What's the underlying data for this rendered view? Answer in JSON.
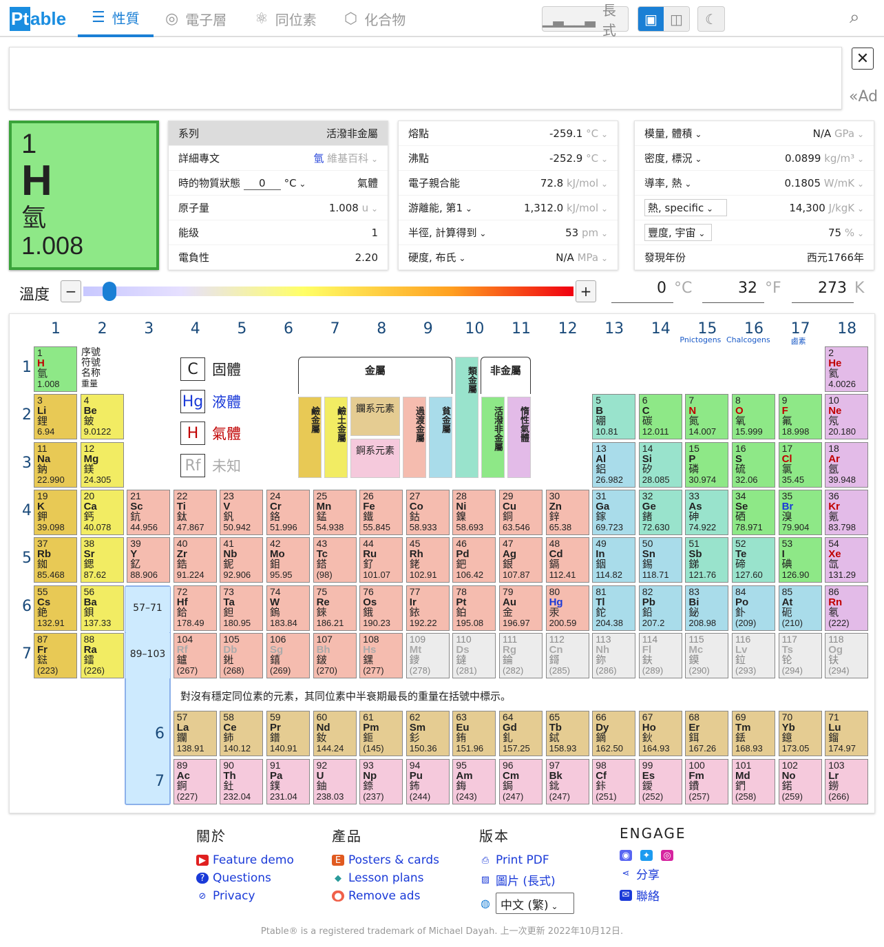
{
  "nav": {
    "logo_pt": "Pt",
    "logo_rest": "able",
    "tabs": [
      "性質",
      "電子層",
      "同位素",
      "化合物"
    ],
    "wide_label": "長式"
  },
  "ad": {
    "tag": "«Ad",
    "close": "✕"
  },
  "element": {
    "number": "1",
    "symbol": "H",
    "name": "氫",
    "mass": "1.008"
  },
  "panel1": [
    {
      "k": "系列",
      "v": "活潑非金屬",
      "u": ""
    },
    {
      "k": "詳細專文",
      "v": "氫",
      "u": "維基百科"
    },
    {
      "k": "時的物質狀態",
      "t": "0",
      "tu": "°C",
      "v": "氣體",
      "u": ""
    },
    {
      "k": "原子量",
      "v": "1.008",
      "u": "u"
    },
    {
      "k": "能级",
      "v": "1",
      "u": ""
    },
    {
      "k": "電負性",
      "v": "2.20",
      "u": ""
    }
  ],
  "panel2": [
    {
      "k": "熔點",
      "v": "-259.1",
      "u": "°C"
    },
    {
      "k": "沸點",
      "v": "-252.9",
      "u": "°C"
    },
    {
      "k": "電子親合能",
      "v": "72.8",
      "u": "kJ/mol"
    },
    {
      "k": "游離能, 第1",
      "v": "1,312.0",
      "u": "kJ/mol"
    },
    {
      "k": "半徑, 計算得到",
      "v": "53",
      "u": "pm"
    },
    {
      "k": "硬度, 布氏",
      "v": "N/A",
      "u": "MPa"
    }
  ],
  "panel3": [
    {
      "k": "模量, 體積",
      "v": "N/A",
      "u": "GPa"
    },
    {
      "k": "密度, 標況",
      "v": "0.0899",
      "u": "kg/m³"
    },
    {
      "k": "導率, 熱",
      "v": "0.1805",
      "u": "W/mK"
    },
    {
      "k": "熱, specific",
      "v": "14,300",
      "u": "J/kgK"
    },
    {
      "k": "豐度, 宇宙",
      "v": "75",
      "u": "%"
    },
    {
      "k": "發現年份",
      "v": "西元1766年",
      "u": ""
    }
  ],
  "temperature": {
    "label": "溫度",
    "minus": "−",
    "plus": "+",
    "c": "0",
    "c_unit": "°C",
    "f": "32",
    "f_unit": "°F",
    "k": "273",
    "k_unit": "K",
    "slider_fraction": 0.05
  },
  "table": {
    "groups": [
      "1",
      "2",
      "3",
      "4",
      "5",
      "6",
      "7",
      "8",
      "9",
      "10",
      "11",
      "12",
      "13",
      "14",
      "15",
      "16",
      "17",
      "18"
    ],
    "group_sub": {
      "15": "Pnictogens",
      "16": "Chalcogens",
      "17": "鹵素"
    },
    "periods": [
      "1",
      "2",
      "3",
      "4",
      "5",
      "6",
      "7"
    ],
    "key_lines": [
      "序號",
      "符號",
      "名称",
      "重量"
    ],
    "legend": [
      {
        "sym": "C",
        "label": "固體",
        "cls": ""
      },
      {
        "sym": "Hg",
        "label": "液體",
        "cls": "liq"
      },
      {
        "sym": "H",
        "label": "氣體",
        "cls": "gas"
      },
      {
        "sym": "Rf",
        "label": "未知",
        "cls": "unk"
      }
    ],
    "cat_metals": "金屬",
    "cat_nonmetals": "非金屬",
    "cat_lan": "鑭系元素",
    "cat_act": "錒系元素",
    "cat_vertical": [
      "鹼金屬",
      "鹼土金屬",
      "過渡金屬",
      "貧金屬",
      "類金屬",
      "活潑非金屬",
      "惰性氣體"
    ],
    "lan_range": "57–71",
    "act_range": "89–103",
    "note": "對沒有穩定同位素的元素，其同位素中半衰期最長的重量在括號中標示。",
    "lan_period": "6",
    "act_period": "7"
  },
  "elements": [
    [
      "1",
      "H",
      "氫",
      "1.008",
      1,
      1,
      "non",
      "gas"
    ],
    [
      "2",
      "He",
      "氦",
      "4.0026",
      18,
      1,
      "nob",
      "gas"
    ],
    [
      "3",
      "Li",
      "鋰",
      "6.94",
      1,
      2,
      "alk",
      ""
    ],
    [
      "4",
      "Be",
      "鈹",
      "9.0122",
      2,
      2,
      "alke",
      ""
    ],
    [
      "5",
      "B",
      "硼",
      "10.81",
      13,
      2,
      "met",
      ""
    ],
    [
      "6",
      "C",
      "碳",
      "12.011",
      14,
      2,
      "non",
      ""
    ],
    [
      "7",
      "N",
      "氮",
      "14.007",
      15,
      2,
      "non",
      "gas"
    ],
    [
      "8",
      "O",
      "氧",
      "15.999",
      16,
      2,
      "non",
      "gas"
    ],
    [
      "9",
      "F",
      "氟",
      "18.998",
      17,
      2,
      "hal",
      "gas"
    ],
    [
      "10",
      "Ne",
      "氖",
      "20.180",
      18,
      2,
      "nob",
      "gas"
    ],
    [
      "11",
      "Na",
      "鈉",
      "22.990",
      1,
      3,
      "alk",
      ""
    ],
    [
      "12",
      "Mg",
      "鎂",
      "24.305",
      2,
      3,
      "alke",
      ""
    ],
    [
      "13",
      "Al",
      "鋁",
      "26.982",
      13,
      3,
      "ptm",
      ""
    ],
    [
      "14",
      "Si",
      "矽",
      "28.085",
      14,
      3,
      "met",
      ""
    ],
    [
      "15",
      "P",
      "磷",
      "30.974",
      15,
      3,
      "non",
      ""
    ],
    [
      "16",
      "S",
      "硫",
      "32.06",
      16,
      3,
      "non",
      ""
    ],
    [
      "17",
      "Cl",
      "氯",
      "35.45",
      17,
      3,
      "hal",
      "gas"
    ],
    [
      "18",
      "Ar",
      "氬",
      "39.948",
      18,
      3,
      "nob",
      "gas"
    ],
    [
      "19",
      "K",
      "鉀",
      "39.098",
      1,
      4,
      "alk",
      ""
    ],
    [
      "20",
      "Ca",
      "鈣",
      "40.078",
      2,
      4,
      "alke",
      ""
    ],
    [
      "21",
      "Sc",
      "鈧",
      "44.956",
      3,
      4,
      "tm",
      ""
    ],
    [
      "22",
      "Ti",
      "鈦",
      "47.867",
      4,
      4,
      "tm",
      ""
    ],
    [
      "23",
      "V",
      "釩",
      "50.942",
      5,
      4,
      "tm",
      ""
    ],
    [
      "24",
      "Cr",
      "鉻",
      "51.996",
      6,
      4,
      "tm",
      ""
    ],
    [
      "25",
      "Mn",
      "錳",
      "54.938",
      7,
      4,
      "tm",
      ""
    ],
    [
      "26",
      "Fe",
      "鐵",
      "55.845",
      8,
      4,
      "tm",
      ""
    ],
    [
      "27",
      "Co",
      "鈷",
      "58.933",
      9,
      4,
      "tm",
      ""
    ],
    [
      "28",
      "Ni",
      "鎳",
      "58.693",
      10,
      4,
      "tm",
      ""
    ],
    [
      "29",
      "Cu",
      "銅",
      "63.546",
      11,
      4,
      "tm",
      ""
    ],
    [
      "30",
      "Zn",
      "鋅",
      "65.38",
      12,
      4,
      "tm",
      ""
    ],
    [
      "31",
      "Ga",
      "鎵",
      "69.723",
      13,
      4,
      "ptm",
      ""
    ],
    [
      "32",
      "Ge",
      "鍺",
      "72.630",
      14,
      4,
      "met",
      ""
    ],
    [
      "33",
      "As",
      "砷",
      "74.922",
      15,
      4,
      "met",
      ""
    ],
    [
      "34",
      "Se",
      "硒",
      "78.971",
      16,
      4,
      "non",
      ""
    ],
    [
      "35",
      "Br",
      "溴",
      "79.904",
      17,
      4,
      "hal",
      "liq"
    ],
    [
      "36",
      "Kr",
      "氪",
      "83.798",
      18,
      4,
      "nob",
      "gas"
    ],
    [
      "37",
      "Rb",
      "銣",
      "85.468",
      1,
      5,
      "alk",
      ""
    ],
    [
      "38",
      "Sr",
      "鍶",
      "87.62",
      2,
      5,
      "alke",
      ""
    ],
    [
      "39",
      "Y",
      "釔",
      "88.906",
      3,
      5,
      "tm",
      ""
    ],
    [
      "40",
      "Zr",
      "鋯",
      "91.224",
      4,
      5,
      "tm",
      ""
    ],
    [
      "41",
      "Nb",
      "鈮",
      "92.906",
      5,
      5,
      "tm",
      ""
    ],
    [
      "42",
      "Mo",
      "鉬",
      "95.95",
      6,
      5,
      "tm",
      ""
    ],
    [
      "43",
      "Tc",
      "鎝",
      "(98)",
      7,
      5,
      "tm",
      ""
    ],
    [
      "44",
      "Ru",
      "釕",
      "101.07",
      8,
      5,
      "tm",
      ""
    ],
    [
      "45",
      "Rh",
      "銠",
      "102.91",
      9,
      5,
      "tm",
      ""
    ],
    [
      "46",
      "Pd",
      "鈀",
      "106.42",
      10,
      5,
      "tm",
      ""
    ],
    [
      "47",
      "Ag",
      "銀",
      "107.87",
      11,
      5,
      "tm",
      ""
    ],
    [
      "48",
      "Cd",
      "鎘",
      "112.41",
      12,
      5,
      "tm",
      ""
    ],
    [
      "49",
      "In",
      "銦",
      "114.82",
      13,
      5,
      "ptm",
      ""
    ],
    [
      "50",
      "Sn",
      "錫",
      "118.71",
      14,
      5,
      "ptm",
      ""
    ],
    [
      "51",
      "Sb",
      "銻",
      "121.76",
      15,
      5,
      "met",
      ""
    ],
    [
      "52",
      "Te",
      "碲",
      "127.60",
      16,
      5,
      "met",
      ""
    ],
    [
      "53",
      "I",
      "碘",
      "126.90",
      17,
      5,
      "hal",
      ""
    ],
    [
      "54",
      "Xe",
      "氙",
      "131.29",
      18,
      5,
      "nob",
      "gas"
    ],
    [
      "55",
      "Cs",
      "銫",
      "132.91",
      1,
      6,
      "alk",
      ""
    ],
    [
      "56",
      "Ba",
      "鋇",
      "137.33",
      2,
      6,
      "alke",
      ""
    ],
    [
      "72",
      "Hf",
      "鉿",
      "178.49",
      4,
      6,
      "tm",
      ""
    ],
    [
      "73",
      "Ta",
      "鉭",
      "180.95",
      5,
      6,
      "tm",
      ""
    ],
    [
      "74",
      "W",
      "鎢",
      "183.84",
      6,
      6,
      "tm",
      ""
    ],
    [
      "75",
      "Re",
      "錸",
      "186.21",
      7,
      6,
      "tm",
      ""
    ],
    [
      "76",
      "Os",
      "鋨",
      "190.23",
      8,
      6,
      "tm",
      ""
    ],
    [
      "77",
      "Ir",
      "銥",
      "192.22",
      9,
      6,
      "tm",
      ""
    ],
    [
      "78",
      "Pt",
      "鉑",
      "195.08",
      10,
      6,
      "tm",
      ""
    ],
    [
      "79",
      "Au",
      "金",
      "196.97",
      11,
      6,
      "tm",
      ""
    ],
    [
      "80",
      "Hg",
      "汞",
      "200.59",
      12,
      6,
      "tm",
      "liq"
    ],
    [
      "81",
      "Tl",
      "鉈",
      "204.38",
      13,
      6,
      "ptm",
      ""
    ],
    [
      "82",
      "Pb",
      "鉛",
      "207.2",
      14,
      6,
      "ptm",
      ""
    ],
    [
      "83",
      "Bi",
      "鉍",
      "208.98",
      15,
      6,
      "ptm",
      ""
    ],
    [
      "84",
      "Po",
      "釙",
      "(209)",
      16,
      6,
      "ptm",
      ""
    ],
    [
      "85",
      "At",
      "砈",
      "(210)",
      17,
      6,
      "ptm",
      ""
    ],
    [
      "86",
      "Rn",
      "氡",
      "(222)",
      18,
      6,
      "nob",
      "gas"
    ],
    [
      "87",
      "Fr",
      "鍅",
      "(223)",
      1,
      7,
      "alk",
      ""
    ],
    [
      "88",
      "Ra",
      "鐳",
      "(226)",
      2,
      7,
      "alke",
      ""
    ],
    [
      "104",
      "Rf",
      "鑪",
      "(267)",
      4,
      7,
      "tm",
      "unk"
    ],
    [
      "105",
      "Db",
      "𨧀",
      "(268)",
      5,
      7,
      "tm",
      "unk"
    ],
    [
      "106",
      "Sg",
      "𨭎",
      "(269)",
      6,
      7,
      "tm",
      "unk"
    ],
    [
      "107",
      "Bh",
      "𨨏",
      "(270)",
      7,
      7,
      "tm",
      "unk"
    ],
    [
      "108",
      "Hs",
      "𨭆",
      "(277)",
      8,
      7,
      "tm",
      "unk"
    ],
    [
      "109",
      "Mt",
      "䥑",
      "(278)",
      9,
      7,
      "unk",
      "unk"
    ],
    [
      "110",
      "Ds",
      "鐽",
      "(281)",
      10,
      7,
      "unk",
      "unk"
    ],
    [
      "111",
      "Rg",
      "錀",
      "(282)",
      11,
      7,
      "unk",
      "unk"
    ],
    [
      "112",
      "Cn",
      "鎶",
      "(285)",
      12,
      7,
      "unk",
      "unk"
    ],
    [
      "113",
      "Nh",
      "鉨",
      "(286)",
      13,
      7,
      "unk",
      "unk"
    ],
    [
      "114",
      "Fl",
      "鈇",
      "(289)",
      14,
      7,
      "unk",
      "unk"
    ],
    [
      "115",
      "Mc",
      "鏌",
      "(290)",
      15,
      7,
      "unk",
      "unk"
    ],
    [
      "116",
      "Lv",
      "鉝",
      "(293)",
      16,
      7,
      "unk",
      "unk"
    ],
    [
      "117",
      "Ts",
      "𬬭",
      "(294)",
      17,
      7,
      "unk",
      "unk"
    ],
    [
      "118",
      "Og",
      "𫓧",
      "(294)",
      18,
      7,
      "unk",
      "unk"
    ],
    [
      "57",
      "La",
      "鑭",
      "138.91",
      4,
      9,
      "lan",
      ""
    ],
    [
      "58",
      "Ce",
      "鈰",
      "140.12",
      5,
      9,
      "lan",
      ""
    ],
    [
      "59",
      "Pr",
      "鐠",
      "140.91",
      6,
      9,
      "lan",
      ""
    ],
    [
      "60",
      "Nd",
      "釹",
      "144.24",
      7,
      9,
      "lan",
      ""
    ],
    [
      "61",
      "Pm",
      "鉕",
      "(145)",
      8,
      9,
      "lan",
      ""
    ],
    [
      "62",
      "Sm",
      "釤",
      "150.36",
      9,
      9,
      "lan",
      ""
    ],
    [
      "63",
      "Eu",
      "銪",
      "151.96",
      10,
      9,
      "lan",
      ""
    ],
    [
      "64",
      "Gd",
      "釓",
      "157.25",
      11,
      9,
      "lan",
      ""
    ],
    [
      "65",
      "Tb",
      "鋱",
      "158.93",
      12,
      9,
      "lan",
      ""
    ],
    [
      "66",
      "Dy",
      "鏑",
      "162.50",
      13,
      9,
      "lan",
      ""
    ],
    [
      "67",
      "Ho",
      "鈥",
      "164.93",
      14,
      9,
      "lan",
      ""
    ],
    [
      "68",
      "Er",
      "鉺",
      "167.26",
      15,
      9,
      "lan",
      ""
    ],
    [
      "69",
      "Tm",
      "銩",
      "168.93",
      16,
      9,
      "lan",
      ""
    ],
    [
      "70",
      "Yb",
      "鐿",
      "173.05",
      17,
      9,
      "lan",
      ""
    ],
    [
      "71",
      "Lu",
      "鎦",
      "174.97",
      18,
      9,
      "lan",
      ""
    ],
    [
      "89",
      "Ac",
      "錒",
      "(227)",
      4,
      10,
      "act",
      ""
    ],
    [
      "90",
      "Th",
      "釷",
      "232.04",
      5,
      10,
      "act",
      ""
    ],
    [
      "91",
      "Pa",
      "鏷",
      "231.04",
      6,
      10,
      "act",
      ""
    ],
    [
      "92",
      "U",
      "鈾",
      "238.03",
      7,
      10,
      "act",
      ""
    ],
    [
      "93",
      "Np",
      "錼",
      "(237)",
      8,
      10,
      "act",
      ""
    ],
    [
      "94",
      "Pu",
      "鈽",
      "(244)",
      9,
      10,
      "act",
      ""
    ],
    [
      "95",
      "Am",
      "鋂",
      "(243)",
      10,
      10,
      "act",
      ""
    ],
    [
      "96",
      "Cm",
      "鋦",
      "(247)",
      11,
      10,
      "act",
      ""
    ],
    [
      "97",
      "Bk",
      "鉳",
      "(247)",
      12,
      10,
      "act",
      ""
    ],
    [
      "98",
      "Cf",
      "鉲",
      "(251)",
      13,
      10,
      "act",
      ""
    ],
    [
      "99",
      "Es",
      "鑀",
      "(252)",
      14,
      10,
      "act",
      ""
    ],
    [
      "100",
      "Fm",
      "鐨",
      "(257)",
      15,
      10,
      "act",
      ""
    ],
    [
      "101",
      "Md",
      "鍆",
      "(258)",
      16,
      10,
      "act",
      ""
    ],
    [
      "102",
      "No",
      "鍩",
      "(259)",
      17,
      10,
      "act",
      ""
    ],
    [
      "103",
      "Lr",
      "鐒",
      "(266)",
      18,
      10,
      "act",
      ""
    ]
  ],
  "footer": {
    "about": {
      "title": "關於",
      "items": [
        "Feature demo",
        "Questions",
        "Privacy"
      ]
    },
    "products": {
      "title": "產品",
      "items": [
        "Posters & cards",
        "Lesson plans",
        "Remove ads"
      ]
    },
    "version": {
      "title": "版本",
      "items": [
        "Print PDF",
        "圖片 (長式)"
      ],
      "lang": "中文 (繁)"
    },
    "engage": {
      "title": "ENGAGE",
      "items": [
        "分享",
        "聯絡"
      ]
    },
    "copyright": "Ptable® is a registered trademark of Michael Dayah. 上一次更新 2022年10月12日."
  }
}
